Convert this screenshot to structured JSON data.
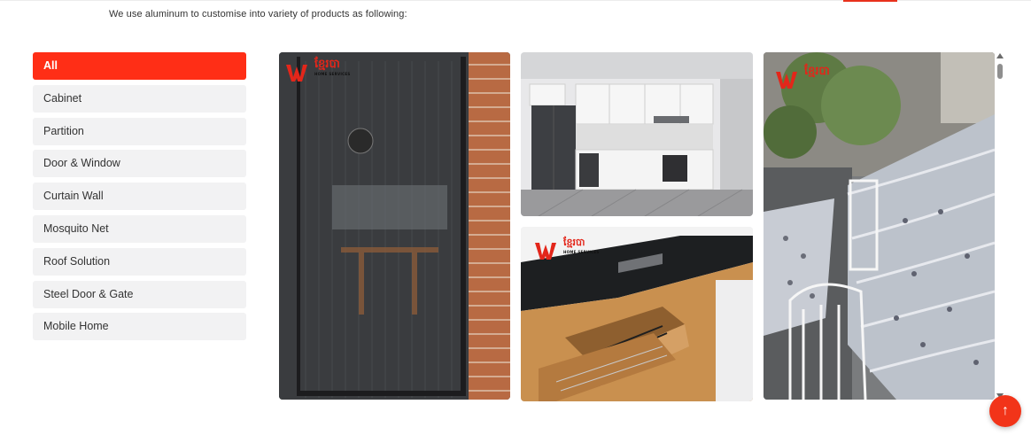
{
  "intro": {
    "text": "We use aluminum to customise into variety of products as following:"
  },
  "categories": [
    {
      "label": "All",
      "active": true
    },
    {
      "label": "Cabinet",
      "active": false
    },
    {
      "label": "Partition",
      "active": false
    },
    {
      "label": "Door & Window",
      "active": false
    },
    {
      "label": "Curtain Wall",
      "active": false
    },
    {
      "label": "Mosquito Net",
      "active": false
    },
    {
      "label": "Roof Solution",
      "active": false
    },
    {
      "label": "Steel Door & Gate",
      "active": false
    },
    {
      "label": "Mobile Home",
      "active": false
    }
  ],
  "gallery": {
    "logo": {
      "brand": "ខ្មែរបា",
      "sub": "HOME SERVICES"
    },
    "images": [
      {
        "name": "mosquito-net-door-photo"
      },
      {
        "name": "white-kitchen-cabinet-photo"
      },
      {
        "name": "wood-kitchen-drawer-photo"
      },
      {
        "name": "polycarbonate-roof-photo"
      }
    ]
  },
  "back_to_top": {
    "icon": "arrow-up-icon",
    "glyph": "↑"
  },
  "colors": {
    "accent": "#ff2e16",
    "sidebar_bg": "#f2f2f3"
  }
}
